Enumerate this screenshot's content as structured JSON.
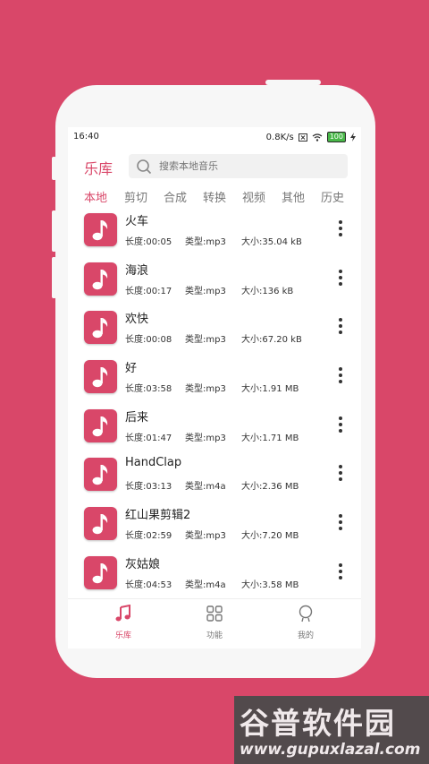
{
  "status_bar": {
    "time": "16:40",
    "speed": "0.8K/s",
    "battery": "100"
  },
  "header": {
    "title": "乐库",
    "search_placeholder": "搜索本地音乐"
  },
  "tabs": [
    {
      "label": "本地",
      "active": true
    },
    {
      "label": "剪切"
    },
    {
      "label": "合成"
    },
    {
      "label": "转换"
    },
    {
      "label": "视频"
    },
    {
      "label": "其他"
    },
    {
      "label": "历史"
    }
  ],
  "songs": [
    {
      "title": "火车",
      "length": "长度:00:05",
      "type": "类型:mp3",
      "size": "大小:35.04 kB"
    },
    {
      "title": "海浪",
      "length": "长度:00:17",
      "type": "类型:mp3",
      "size": "大小:136 kB"
    },
    {
      "title": "欢快",
      "length": "长度:00:08",
      "type": "类型:mp3",
      "size": "大小:67.20 kB"
    },
    {
      "title": "好",
      "length": "长度:03:58",
      "type": "类型:mp3",
      "size": "大小:1.91 MB"
    },
    {
      "title": "后来",
      "length": "长度:01:47",
      "type": "类型:mp3",
      "size": "大小:1.71 MB"
    },
    {
      "title": "HandClap",
      "length": "长度:03:13",
      "type": "类型:m4a",
      "size": "大小:2.36 MB"
    },
    {
      "title": "红山果剪辑2",
      "length": "长度:02:59",
      "type": "类型:mp3",
      "size": "大小:7.20 MB"
    },
    {
      "title": "灰姑娘",
      "length": "长度:04:53",
      "type": "类型:m4a",
      "size": "大小:3.58 MB"
    }
  ],
  "bottom_nav": [
    {
      "label": "乐库",
      "icon": "music-note-icon",
      "active": true
    },
    {
      "label": "功能",
      "icon": "grid-icon"
    },
    {
      "label": "我的",
      "icon": "profile-icon"
    }
  ],
  "watermark": {
    "title": "谷普软件园",
    "url": "www.gupuxlazal.com"
  },
  "colors": {
    "accent": "#d94769",
    "background": "#d94769"
  }
}
